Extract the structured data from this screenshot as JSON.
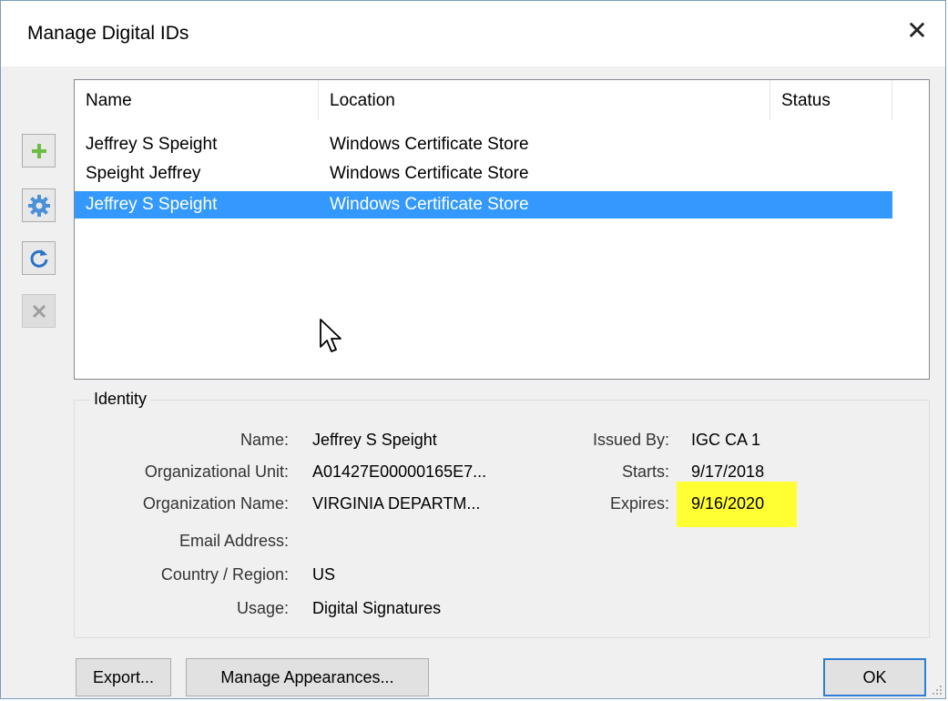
{
  "window": {
    "title": "Manage Digital IDs"
  },
  "toolbar": {
    "icons": [
      "add-icon",
      "gear-icon",
      "refresh-icon",
      "remove-icon"
    ],
    "accent": "#3399ff"
  },
  "list": {
    "columns": [
      "Name",
      "Location",
      "Status"
    ],
    "rows": [
      {
        "name": "Jeffrey S Speight",
        "location": "Windows Certificate Store",
        "status": ""
      },
      {
        "name": "Speight Jeffrey",
        "location": "Windows Certificate Store",
        "status": ""
      },
      {
        "name": "Jeffrey S Speight",
        "location": "Windows Certificate Store",
        "status": "",
        "selected": true
      }
    ]
  },
  "identity": {
    "group_label": "Identity",
    "name_label": "Name:",
    "name": "Jeffrey S Speight",
    "org_unit_label": "Organizational Unit:",
    "org_unit": "A01427E00000165E7...",
    "org_name_label": "Organization Name:",
    "org_name": "VIRGINIA DEPARTM...",
    "email_label": "Email Address:",
    "email": "",
    "country_label": "Country / Region:",
    "country": "US",
    "usage_label": "Usage:",
    "usage": "Digital Signatures",
    "issued_by_label": "Issued By:",
    "issued_by": "IGC CA 1",
    "starts_label": "Starts:",
    "starts": "9/17/2018",
    "expires_label": "Expires:",
    "expires": "9/16/2020",
    "highlight_color": "#ffff33"
  },
  "buttons": {
    "export": "Export...",
    "manage_appearances": "Manage Appearances...",
    "ok": "OK"
  }
}
